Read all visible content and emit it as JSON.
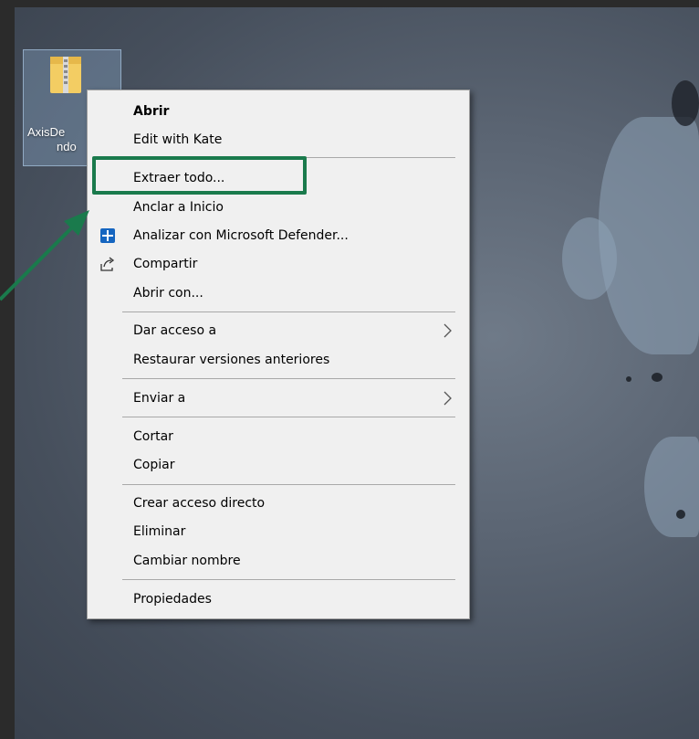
{
  "desktop": {
    "icon_name_line1": "AxisDe",
    "icon_name_line2": "ndo",
    "icon_type": "zip-folder-icon"
  },
  "context_menu": {
    "items": [
      {
        "label": "Abrir",
        "bold": true
      },
      {
        "label": "Edit with Kate"
      },
      {
        "label": "Extraer todo...",
        "highlighted": true
      },
      {
        "label": "Anclar a Inicio"
      },
      {
        "label": "Analizar con Microsoft Defender...",
        "icon": "defender-shield-icon"
      },
      {
        "label": "Compartir",
        "icon": "share-icon"
      },
      {
        "label": "Abrir con..."
      },
      {
        "label": "Dar acceso a",
        "submenu": true
      },
      {
        "label": "Restaurar versiones anteriores"
      },
      {
        "label": "Enviar a",
        "submenu": true
      },
      {
        "label": "Cortar"
      },
      {
        "label": "Copiar"
      },
      {
        "label": "Crear acceso directo"
      },
      {
        "label": "Eliminar"
      },
      {
        "label": "Cambiar nombre"
      },
      {
        "label": "Propiedades"
      }
    ]
  },
  "annotation": {
    "highlight_color": "#1a7a4c",
    "arrow_color": "#1a7a4c"
  }
}
